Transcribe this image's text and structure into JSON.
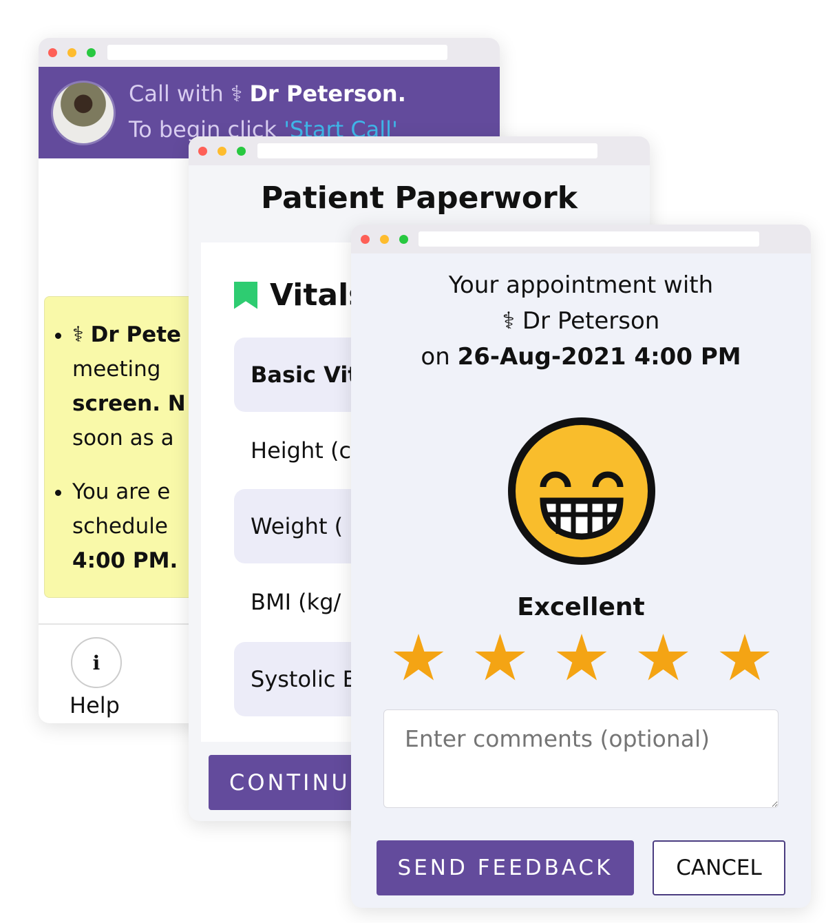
{
  "call_window": {
    "header_prefix": "Call with",
    "doctor_name": "Dr Peterson.",
    "instruction_prefix": "To begin click",
    "instruction_link": "'Start Call'",
    "notes": [
      {
        "icon": "doctor-icon",
        "bold": "Dr Pete",
        "lines": [
          "meeting",
          "screen. N",
          "soon as a"
        ]
      },
      {
        "lines": [
          "You are e",
          "schedule"
        ],
        "bold": "4:00 PM."
      }
    ],
    "help_label": "Help"
  },
  "paperwork_window": {
    "title": "Patient Paperwork",
    "section": "Vitals",
    "rows": [
      "Basic Vit",
      "Height (c",
      "Weight (",
      "BMI (kg/",
      "Systolic B"
    ],
    "continue_label": "CONTINU"
  },
  "feedback_window": {
    "line1": "Your appointment with",
    "doctor": "Dr Peterson",
    "on_prefix": "on",
    "datetime": "26-Aug-2021 4:00 PM",
    "rating_label": "Excellent",
    "rating": 5,
    "rating_max": 5,
    "comment_placeholder": "Enter comments (optional)",
    "send_label": "SEND FEEDBACK",
    "cancel_label": "CANCEL"
  },
  "colors": {
    "primary": "#634b9c",
    "star": "#f4a414",
    "note_bg": "#f9f9a9",
    "bookmark": "#2ecc71",
    "link": "#3fb6e8"
  }
}
